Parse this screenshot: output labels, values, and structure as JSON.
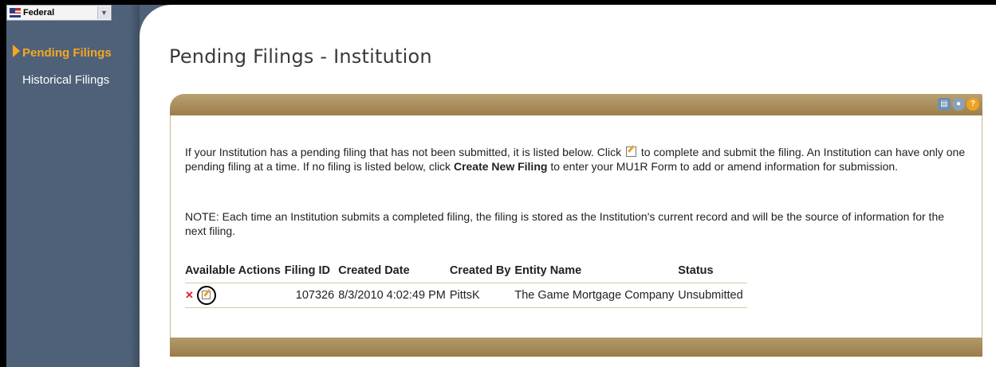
{
  "sidebar": {
    "jurisdiction": "Federal",
    "items": [
      {
        "label": "Pending Filings",
        "active": true
      },
      {
        "label": "Historical Filings",
        "active": false
      }
    ]
  },
  "page_title": "Pending Filings - Institution",
  "panel": {
    "header_icons": [
      "print-icon",
      "user-icon",
      "help-icon"
    ],
    "intro": {
      "part1": "If your Institution has a pending filing that has not been submitted, it is listed below. Click",
      "part2": "to complete and submit the filing. An Institution can have only one pending filing at a time. If no filing is listed below, click",
      "link": "Create New Filing",
      "part3": "to enter your MU1R Form to add or amend information for submission."
    },
    "note": "NOTE: Each time an Institution submits a completed filing, the filing is stored as the Institution's current record and will be the source of information for the next filing."
  },
  "table": {
    "headers": [
      "Available Actions",
      "Filing ID",
      "Created Date",
      "Created By",
      "Entity Name",
      "Status"
    ],
    "rows": [
      {
        "delete_glyph": "✕",
        "filing_id": "107326",
        "created_date": "8/3/2010 4:02:49 PM",
        "created_by": "PittsK",
        "entity_name": "The Game Mortgage Company",
        "status": "Unsubmitted"
      }
    ]
  },
  "colors": {
    "sidebar_bg": "#4f6178",
    "active_nav": "#f6a623",
    "panel_band": "#9c7e4a"
  }
}
